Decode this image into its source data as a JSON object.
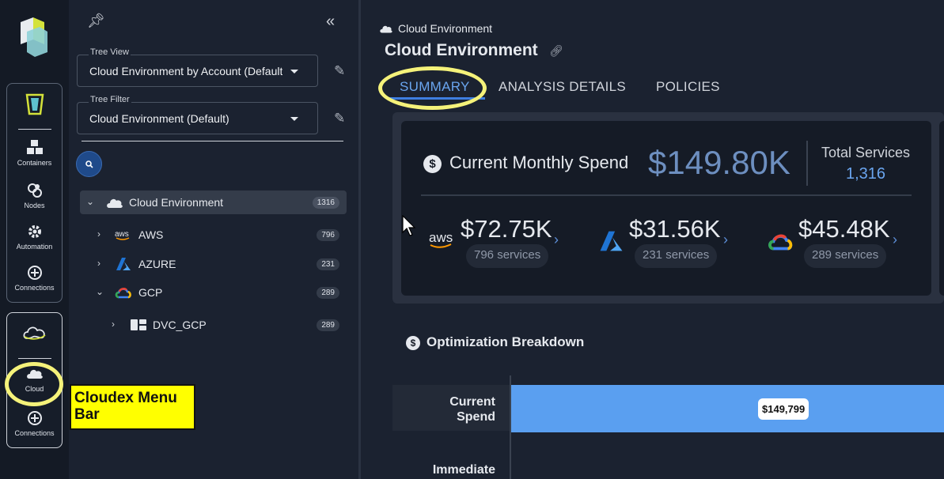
{
  "rail": {
    "items_top": [
      {
        "label": "Containers",
        "icon": "containers-icon"
      },
      {
        "label": "Nodes",
        "icon": "nodes-icon"
      },
      {
        "label": "Automation",
        "icon": "gear-icon"
      },
      {
        "label": "Connections",
        "icon": "plus-circle-icon"
      }
    ],
    "items_bottom": [
      {
        "label": "Cloud",
        "icon": "cloud-icon"
      },
      {
        "label": "Connections",
        "icon": "plus-circle-icon"
      }
    ]
  },
  "tree": {
    "tree_view_label": "Tree View",
    "tree_view_value": "Cloud Environment by Account (Default)",
    "tree_filter_label": "Tree Filter",
    "tree_filter_value": "Cloud Environment (Default)",
    "rows": [
      {
        "label": "Cloud Environment",
        "count": "1316"
      },
      {
        "label": "AWS",
        "count": "796"
      },
      {
        "label": "AZURE",
        "count": "231"
      },
      {
        "label": "GCP",
        "count": "289"
      },
      {
        "label": "DVC_GCP",
        "count": "289"
      }
    ]
  },
  "main": {
    "breadcrumb": "Cloud Environment",
    "title": "Cloud Environment",
    "tabs": [
      "SUMMARY",
      "ANALYSIS DETAILS",
      "POLICIES"
    ],
    "spend_label": "Current Monthly Spend",
    "spend_value": "$149.80K",
    "total_services_label": "Total Services",
    "total_services_value": "1,316",
    "providers": [
      {
        "name": "aws",
        "value": "$72.75K",
        "services": "796 services"
      },
      {
        "name": "azure",
        "value": "$31.56K",
        "services": "231 services"
      },
      {
        "name": "gcp",
        "value": "$45.48K",
        "services": "289 services"
      }
    ],
    "optimization_title": "Optimization Breakdown",
    "rows": [
      {
        "label": "Current Spend",
        "value": "$149,799"
      },
      {
        "label": "Immediate"
      }
    ]
  },
  "callout": "Cloudex Menu Bar",
  "colors": {
    "accent": "#3e7ee0",
    "bar": "#5a9ff0",
    "highlight": "#f5f27a",
    "callout": "#ffff00"
  }
}
